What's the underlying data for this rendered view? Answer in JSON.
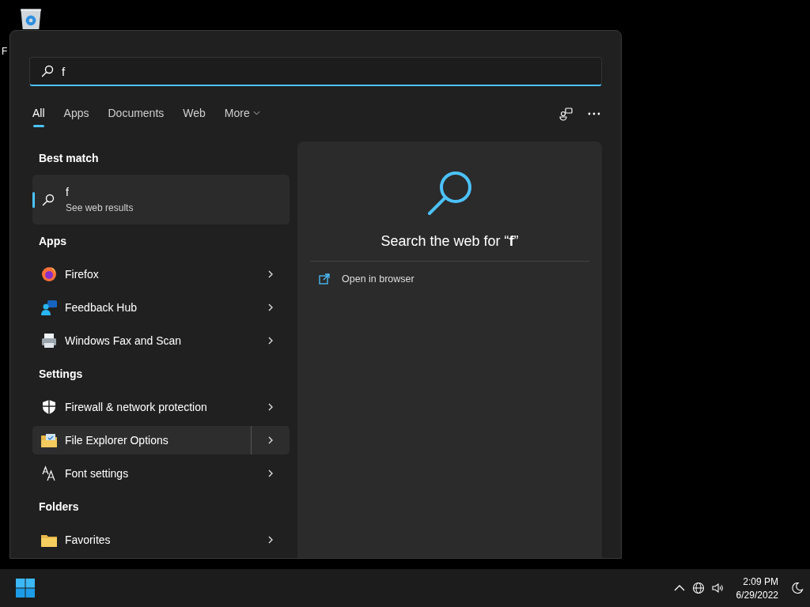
{
  "desktop": {
    "icons": [
      {
        "label": "F"
      }
    ]
  },
  "search_panel": {
    "search": {
      "value": "f"
    },
    "tabs": [
      {
        "label": "All",
        "selected": true,
        "kind": "plain"
      },
      {
        "label": "Apps",
        "selected": false,
        "kind": "plain"
      },
      {
        "label": "Documents",
        "selected": false,
        "kind": "plain"
      },
      {
        "label": "Web",
        "selected": false,
        "kind": "plain"
      },
      {
        "label": "More",
        "selected": false,
        "kind": "dropdown"
      }
    ],
    "best_match": {
      "heading": "Best match",
      "title": "f",
      "subtitle": "See web results",
      "selected": true
    },
    "groups": [
      {
        "heading": "Apps",
        "items": [
          {
            "label": "Firefox",
            "hovered": false
          },
          {
            "label": "Feedback Hub",
            "hovered": false
          },
          {
            "label": "Windows Fax and Scan",
            "hovered": false
          }
        ]
      },
      {
        "heading": "Settings",
        "items": [
          {
            "label": "Firewall & network protection",
            "hovered": false
          },
          {
            "label": "File Explorer Options",
            "hovered": true
          },
          {
            "label": "Font settings",
            "hovered": false
          }
        ]
      },
      {
        "heading": "Folders",
        "items": [
          {
            "label": "Favorites",
            "hovered": false
          }
        ]
      }
    ],
    "preview": {
      "heading": "Search the web for “**f**”",
      "actions": [
        {
          "label": "Open in browser"
        }
      ]
    }
  },
  "taskbar": {
    "time": "2:09 PM",
    "date": "6/29/2022"
  }
}
